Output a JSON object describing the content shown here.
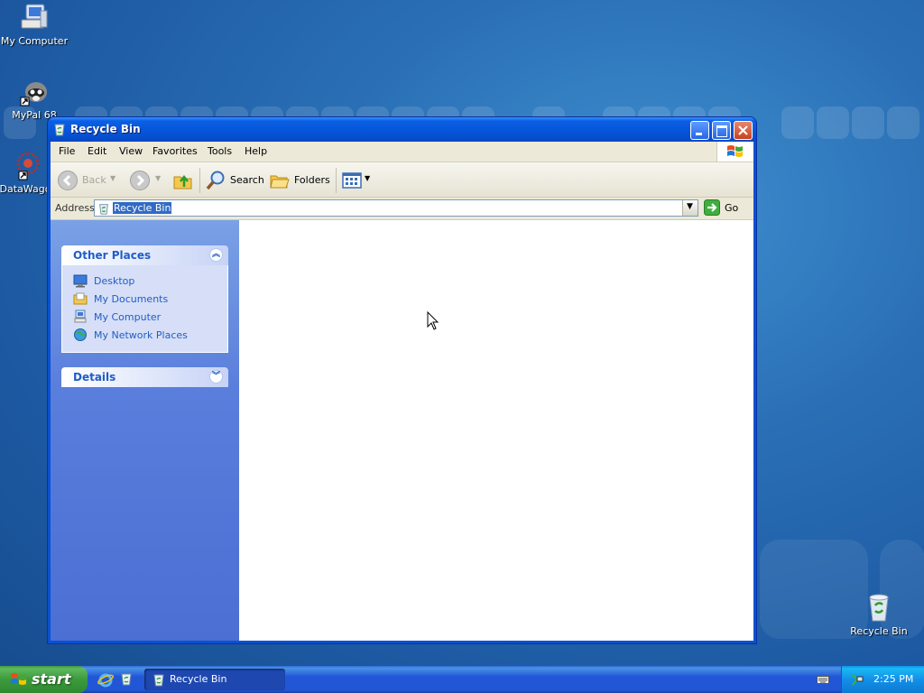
{
  "desktop": {
    "icons": [
      {
        "label": "My Computer",
        "icon": "my-computer-icon"
      },
      {
        "label": "MyPal 68",
        "icon": "mypal-icon"
      },
      {
        "label": "DataWago",
        "icon": "datawagon-icon"
      },
      {
        "label": "Recycle Bin",
        "icon": "recycle-bin-icon"
      }
    ]
  },
  "window": {
    "title": "Recycle Bin",
    "menu": [
      "File",
      "Edit",
      "View",
      "Favorites",
      "Tools",
      "Help"
    ],
    "toolbar": {
      "back_label": "Back",
      "search_label": "Search",
      "folders_label": "Folders"
    },
    "address": {
      "label": "Address",
      "value": "Recycle Bin",
      "go_label": "Go"
    },
    "sidebar": {
      "other_places": {
        "title": "Other Places",
        "items": [
          {
            "label": "Desktop",
            "icon": "desktop-icon"
          },
          {
            "label": "My Documents",
            "icon": "my-documents-icon"
          },
          {
            "label": "My Computer",
            "icon": "my-computer-icon"
          },
          {
            "label": "My Network Places",
            "icon": "network-places-icon"
          }
        ]
      },
      "details": {
        "title": "Details"
      }
    }
  },
  "taskbar": {
    "start_label": "start",
    "task_label": "Recycle Bin",
    "clock": "2:25 PM"
  },
  "colors": {
    "window_frame": "#0a50d2",
    "sidebar_link": "#215dc6",
    "start_green": "#3c9a3c",
    "selection": "#316ac5"
  }
}
